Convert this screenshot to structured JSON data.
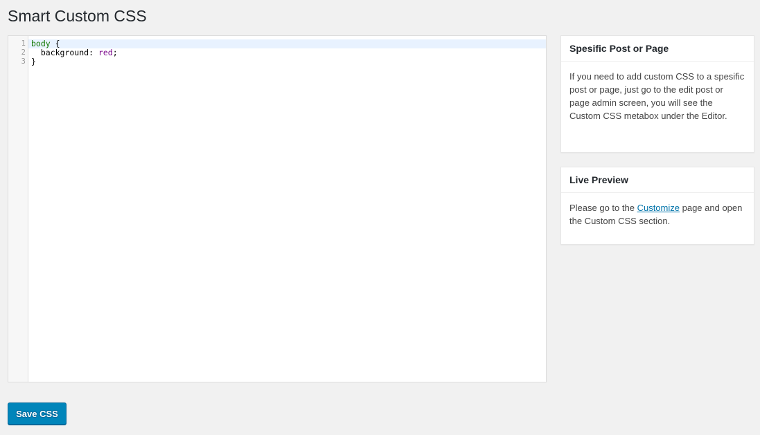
{
  "page": {
    "title": "Smart Custom CSS"
  },
  "editor": {
    "lines": [
      {
        "number": "1",
        "tokens": [
          {
            "text": "body",
            "type": "tag"
          },
          {
            "text": " {",
            "type": "punc"
          }
        ]
      },
      {
        "number": "2",
        "tokens": [
          {
            "text": "  background: ",
            "type": "prop"
          },
          {
            "text": "red",
            "type": "val"
          },
          {
            "text": ";",
            "type": "punc"
          }
        ]
      },
      {
        "number": "3",
        "tokens": [
          {
            "text": "}",
            "type": "punc"
          }
        ]
      }
    ],
    "active_line": 1
  },
  "sidebar": {
    "specific_box": {
      "title": "Spesific Post or Page",
      "body": "If you need to add custom CSS to a spesific post or page, just go to the edit post or page admin screen, you will see the Custom CSS metabox under the Editor."
    },
    "preview_box": {
      "title": "Live Preview",
      "body_before": "Please go to the ",
      "link_text": "Customize",
      "body_after": " page and open the Custom CSS section."
    }
  },
  "actions": {
    "save_label": "Save CSS"
  },
  "colors": {
    "accent": "#0085ba",
    "link": "#0073aa",
    "css_tag": "#117700",
    "css_value": "#770088"
  }
}
